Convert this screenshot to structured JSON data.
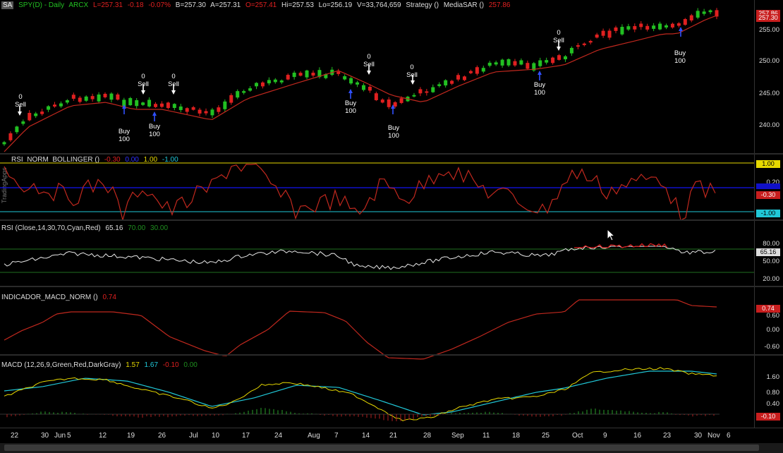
{
  "header": {
    "symbol_box": "SA",
    "symbol": "SPY(D) - Daily",
    "exchange": "ARCX",
    "last": "L=257.31",
    "chg": "-0.18",
    "pct": "-0.07%",
    "bid": "B=257.30",
    "ask": "A=257.31",
    "open": "O=257.41",
    "high": "Hi=257.53",
    "low": "Lo=256.19",
    "volume": "V=33,764,659",
    "strategy": "Strategy ()",
    "mediasar": "MediaSAR ()",
    "mediasar_val": "257.86"
  },
  "price_axis": {
    "ticks": [
      "255.00",
      "250.00",
      "245.00",
      "240.00"
    ],
    "tag_top": "257.86",
    "tag_bottom": "257.30"
  },
  "signals": [
    {
      "qty": "0",
      "label": "Sell"
    },
    {
      "qty": "100",
      "label": "Buy"
    },
    {
      "qty": "0",
      "label": "Sell"
    },
    {
      "qty": "100",
      "label": "Buy"
    },
    {
      "qty": "0",
      "label": "Sell"
    },
    {
      "qty": "100",
      "label": "Buy"
    },
    {
      "qty": "0",
      "label": "Sell"
    },
    {
      "qty": "100",
      "label": "Buy"
    },
    {
      "qty": "0",
      "label": "Sell"
    },
    {
      "qty": "100",
      "label": "Buy"
    },
    {
      "qty": "0",
      "label": "Sell"
    },
    {
      "qty": "100",
      "label": "Buy"
    }
  ],
  "brand": "TradingApps",
  "rsi_norm": {
    "title": "RSI_NORM_BOLLINGER ()",
    "v1": "-0.30",
    "v2": "0.00",
    "v3": "1.00",
    "v4": "-1.00",
    "tags": [
      "1.00",
      "0.20",
      "-0.30",
      "-1.00"
    ]
  },
  "rsi": {
    "title": "RSI (Close,14,30,70,Cyan,Red)",
    "v1": "65.16",
    "v2": "70.00",
    "v3": "30.00",
    "ticks": [
      "80.00",
      "50.00",
      "20.00"
    ],
    "tag": "65.16"
  },
  "macd_norm": {
    "title": "INDICADOR_MACD_NORM ()",
    "v1": "0.74",
    "ticks": [
      "0.60",
      "0.00",
      "-0.60"
    ],
    "tag": "0.74"
  },
  "macd": {
    "title": "MACD (12,26,9,Green,Red,DarkGray)",
    "v1": "1.57",
    "v2": "1.67",
    "v3": "-0.10",
    "v4": "0.00",
    "ticks": [
      "1.60",
      "0.80",
      "0.40"
    ],
    "tag": "-0.10"
  },
  "x_labels": [
    "22",
    "30",
    "Jun",
    "5",
    "12",
    "19",
    "26",
    "Jul",
    "10",
    "17",
    "24",
    "Aug",
    "7",
    "14",
    "21",
    "28",
    "Sep",
    "11",
    "18",
    "25",
    "Oct",
    "9",
    "16",
    "23",
    "30",
    "Nov",
    "6"
  ],
  "colors": {
    "up": "#22c022",
    "down": "#e02020",
    "sar": "#c0281e",
    "rsi_line": "#e8e8e8",
    "yellow": "#e6d800",
    "cyan": "#20c8d8",
    "blue": "#1010c8",
    "green": "#1f6f1f"
  }
}
